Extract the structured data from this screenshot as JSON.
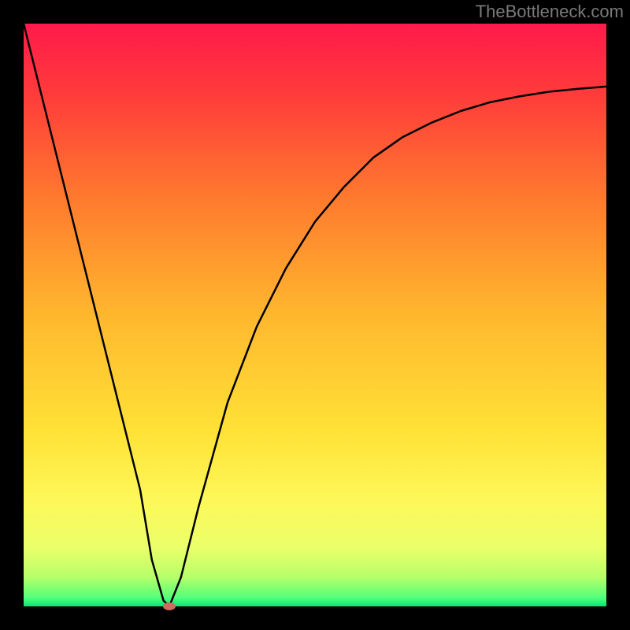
{
  "watermark": "TheBottleneck.com",
  "chart_data": {
    "type": "line",
    "title": "",
    "xlabel": "",
    "ylabel": "",
    "xlim": [
      0,
      100
    ],
    "ylim": [
      0,
      100
    ],
    "x": [
      0,
      5,
      10,
      15,
      20,
      22,
      24,
      25,
      27,
      30,
      35,
      40,
      45,
      50,
      55,
      60,
      65,
      70,
      75,
      80,
      85,
      90,
      95,
      100
    ],
    "values": [
      100,
      80,
      60,
      40,
      20,
      8,
      1,
      0,
      5,
      17,
      35,
      48,
      58,
      66,
      72,
      77,
      80.5,
      83,
      85,
      86.5,
      87.5,
      88.3,
      88.8,
      89.2
    ],
    "minimum_marker": {
      "x": 25,
      "y": 0,
      "color": "#cf6a5f"
    },
    "gradient_stops": [
      {
        "pos": 0.0,
        "color": "#ff1a4b"
      },
      {
        "pos": 0.12,
        "color": "#ff3b3b"
      },
      {
        "pos": 0.3,
        "color": "#ff7a2e"
      },
      {
        "pos": 0.5,
        "color": "#ffb72e"
      },
      {
        "pos": 0.7,
        "color": "#ffe236"
      },
      {
        "pos": 0.82,
        "color": "#fdf85a"
      },
      {
        "pos": 0.9,
        "color": "#eaff6a"
      },
      {
        "pos": 0.95,
        "color": "#b6ff6a"
      },
      {
        "pos": 0.985,
        "color": "#55ff7a"
      },
      {
        "pos": 1.0,
        "color": "#00e878"
      }
    ]
  }
}
